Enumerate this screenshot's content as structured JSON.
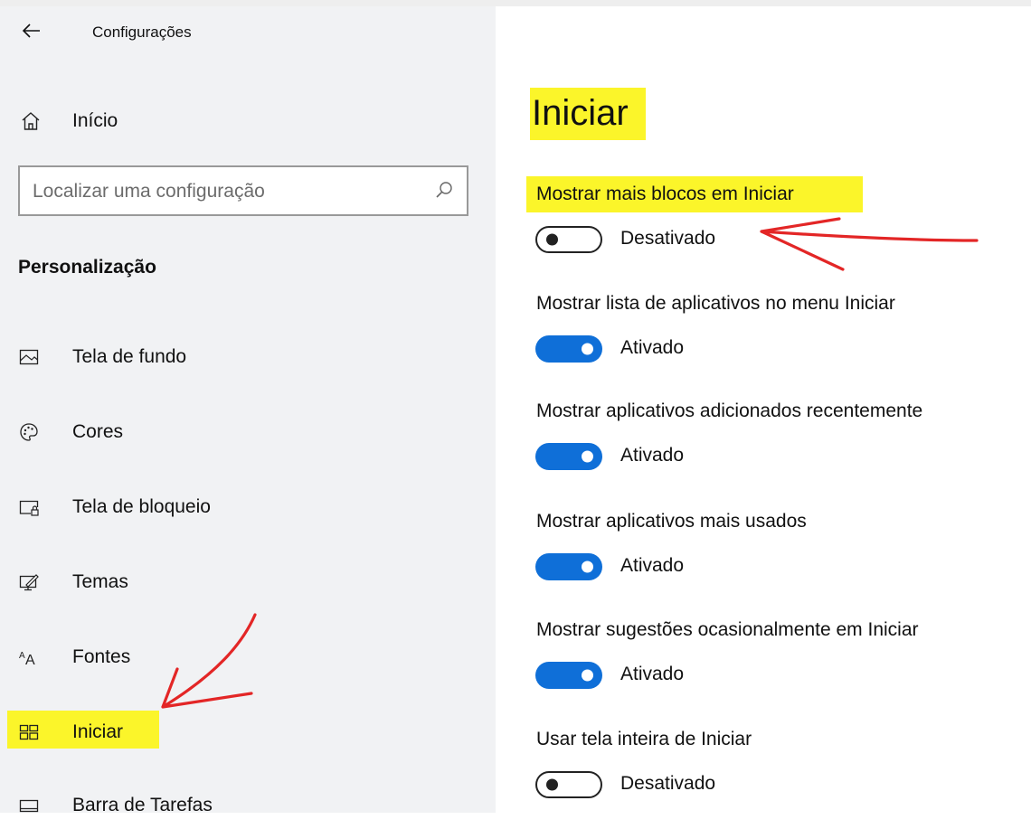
{
  "app": {
    "title": "Configurações"
  },
  "sidebar": {
    "home_label": "Início",
    "search_placeholder": "Localizar uma configuração",
    "section_title": "Personalização",
    "items": [
      {
        "label": "Tela de fundo",
        "icon": "picture-icon"
      },
      {
        "label": "Cores",
        "icon": "palette-icon"
      },
      {
        "label": "Tela de bloqueio",
        "icon": "lock-screen-icon"
      },
      {
        "label": "Temas",
        "icon": "themes-icon"
      },
      {
        "label": "Fontes",
        "icon": "fonts-icon"
      },
      {
        "label": "Iniciar",
        "icon": "start-icon",
        "selected": true
      },
      {
        "label": "Barra de Tarefas",
        "icon": "taskbar-icon"
      }
    ]
  },
  "main": {
    "title": "Iniciar",
    "settings": [
      {
        "label": "Mostrar mais blocos em Iniciar",
        "state": "Desativado",
        "on": false
      },
      {
        "label": "Mostrar lista de aplicativos no menu Iniciar",
        "state": "Ativado",
        "on": true
      },
      {
        "label": "Mostrar aplicativos adicionados recentemente",
        "state": "Ativado",
        "on": true
      },
      {
        "label": "Mostrar aplicativos mais usados",
        "state": "Ativado",
        "on": true
      },
      {
        "label": "Mostrar sugestões ocasionalmente em Iniciar",
        "state": "Ativado",
        "on": true
      },
      {
        "label": "Usar tela inteira de Iniciar",
        "state": "Desativado",
        "on": false
      }
    ]
  },
  "colors": {
    "accent": "#0f6fd8",
    "highlight": "#fbf52a",
    "annotation": "#e32626",
    "sidebar_bg": "#f1f2f4"
  }
}
